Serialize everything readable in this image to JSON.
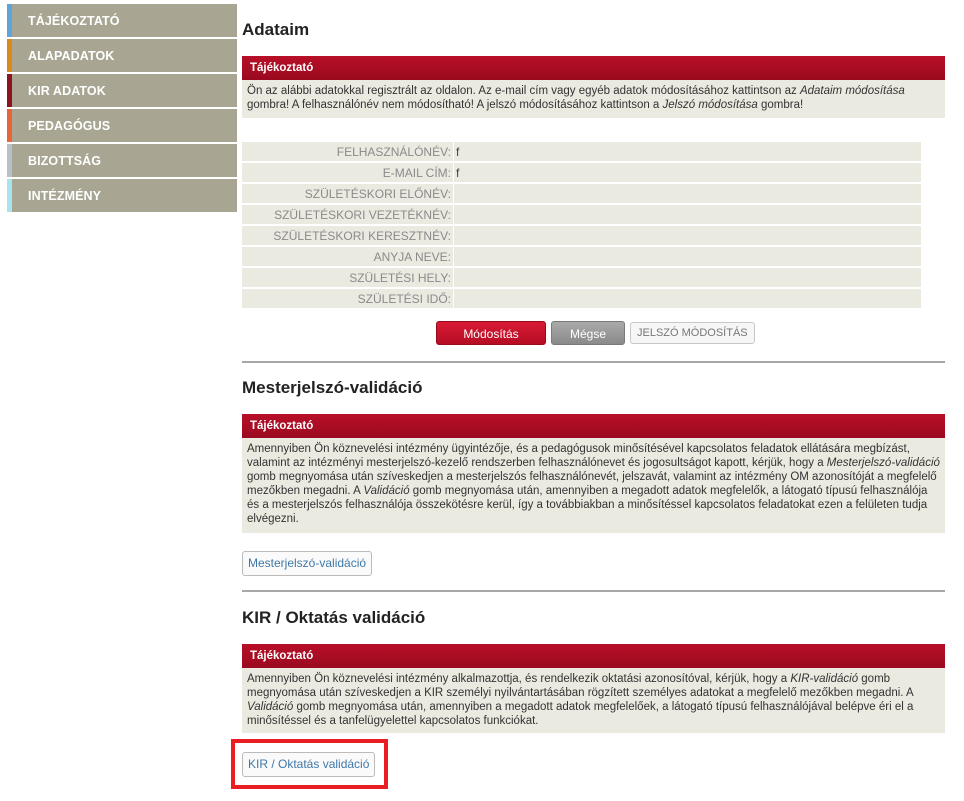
{
  "sidebar": {
    "items": [
      {
        "label": "TÁJÉKOZTATÓ",
        "accent": "#5fa3d8"
      },
      {
        "label": "ALAPADATOK",
        "accent": "#d8891f"
      },
      {
        "label": "KIR ADATOK",
        "accent": "#8c1420"
      },
      {
        "label": "PEDAGÓGUS",
        "accent": "#e8643a"
      },
      {
        "label": "BIZOTTSÁG",
        "accent": "#b7c0c8"
      },
      {
        "label": "INTÉZMÉNY",
        "accent": "#a8e4ec"
      }
    ]
  },
  "adataim": {
    "title": "Adataim",
    "info_title": "Tájékoztató",
    "info_p1": "Ön az alábbi adatokkal regisztrált az oldalon. Az e-mail cím vagy egyéb adatok módosításához kattintson az ",
    "info_em1": "Adataim módosítása",
    "info_p2": " gombra! A felhasználónév nem módosítható! A jelszó módosításához kattintson a ",
    "info_em2": "Jelszó módosítása",
    "info_p3": " gombra!",
    "fields": [
      {
        "label": "FELHASZNÁLÓNÉV:",
        "value": "f"
      },
      {
        "label": "E-MAIL CÍM:",
        "value": "f"
      },
      {
        "label": "SZÜLETÉSKORI ELŐNÉV:",
        "value": ""
      },
      {
        "label": "SZÜLETÉSKORI VEZETÉKNÉV:",
        "value": ""
      },
      {
        "label": "SZÜLETÉSKORI KERESZTNÉV:",
        "value": ""
      },
      {
        "label": "ANYJA NEVE:",
        "value": ""
      },
      {
        "label": "SZÜLETÉSI HELY:",
        "value": ""
      },
      {
        "label": "SZÜLETÉSI IDŐ:",
        "value": ""
      }
    ],
    "btn_modify": "Módosítás",
    "btn_cancel": "Mégse",
    "btn_password": "JELSZÓ MÓDOSÍTÁS"
  },
  "master": {
    "title": "Mesterjelszó-validáció",
    "info_title": "Tájékoztató",
    "p1": "Amennyiben Ön köznevelési intézmény ügyintézője, és a pedagógusok minősítésével kapcsolatos feladatok ellátására megbízást, valamint az intézményi mesterjelszó-kezelő rendszerben felhasználónevet és jogosultságot kapott, kérjük, hogy a ",
    "em1": "Mesterjelszó-validáció",
    "p2": " gomb megnyomása után szíveskedjen a mesterjelszós felhasználónevét, jelszavát, valamint az intézmény OM azonosítóját a megfelelő mezőkben megadni. A ",
    "em2": "Validáció",
    "p3": " gomb megnyomása után, amennyiben a megadott adatok megfelelők, a látogató típusú felhasználója és a mesterjelszós felhasználója összekötésre kerül, így a továbbiakban a minősítéssel kapcsolatos feladatokat ezen a felületen tudja elvégezni.",
    "button": "Mesterjelszó-validáció"
  },
  "kir": {
    "title": "KIR / Oktatás validáció",
    "info_title": "Tájékoztató",
    "p1": "Amennyiben Ön köznevelési intézmény alkalmazottja, és rendelkezik oktatási azonosítóval, kérjük, hogy a ",
    "em1": "KIR-validáció",
    "p2": " gomb megnyomása után szíveskedjen a KIR személyi nyilvántartásában rögzített személyes adatokat a megfelelő mezőkben megadni. A ",
    "em2": "Validáció",
    "p3": " gomb megnyomása után, amennyiben a megadott adatok megfelelőek, a látogató típusú felhasználójával belépve éri el a minősítéssel és a tanfelügyelettel kapcsolatos funkciókat.",
    "button": "KIR / Oktatás validáció"
  },
  "colors": {
    "header_red": "#a90d23",
    "highlight": "#ea1c24",
    "sidebar_bg": "#a8a693"
  }
}
